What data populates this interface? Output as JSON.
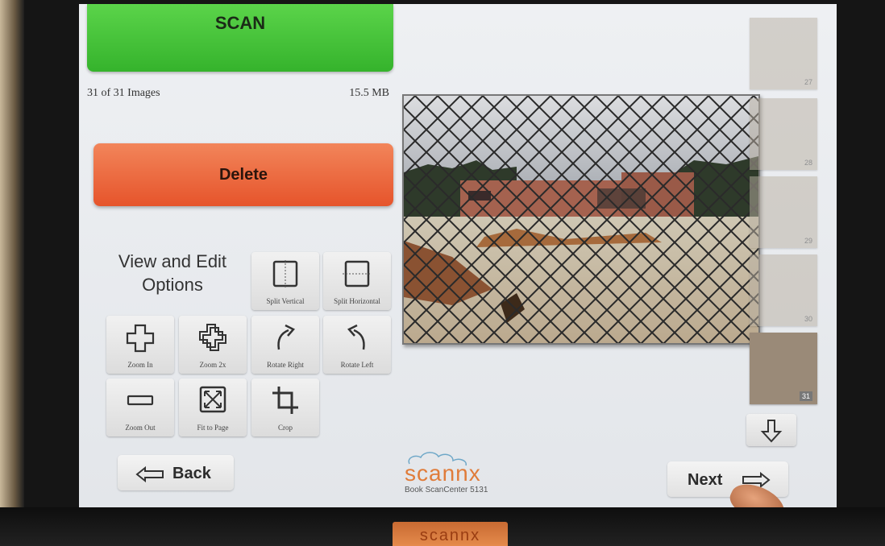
{
  "header": {
    "scan_label": "SCAN"
  },
  "status": {
    "image_count": "31 of 31 Images",
    "size": "15.5 MB"
  },
  "actions": {
    "delete_label": "Delete"
  },
  "view_edit": {
    "title_line1": "View and Edit",
    "title_line2": "Options",
    "tools": {
      "split_vertical": "Split Vertical",
      "split_horizontal": "Split Horizontal",
      "zoom_in": "Zoom In",
      "zoom_2x": "Zoom 2x",
      "rotate_right": "Rotate Right",
      "rotate_left": "Rotate Left",
      "zoom_out": "Zoom Out",
      "fit_to_page": "Fit to Page",
      "crop": "Crop"
    }
  },
  "thumbnails": [
    {
      "num": "27",
      "active": false
    },
    {
      "num": "28",
      "active": false
    },
    {
      "num": "29",
      "active": false
    },
    {
      "num": "30",
      "active": false
    },
    {
      "num": "31",
      "active": true
    }
  ],
  "nav": {
    "back_label": "Back",
    "next_label": "Next"
  },
  "brand": {
    "logo_text": "scannx",
    "station": "Book ScanCenter 5131"
  },
  "icons": [
    "split-vertical-icon",
    "split-horizontal-icon",
    "zoom-in-icon",
    "zoom-2x-icon",
    "rotate-right-icon",
    "rotate-left-icon",
    "zoom-out-icon",
    "fit-to-page-icon",
    "crop-icon",
    "down-arrow-icon",
    "back-arrow-icon",
    "next-arrow-icon"
  ],
  "colors": {
    "scan": "#35b32c",
    "delete": "#e6542b",
    "brand": "#e07c3a"
  }
}
